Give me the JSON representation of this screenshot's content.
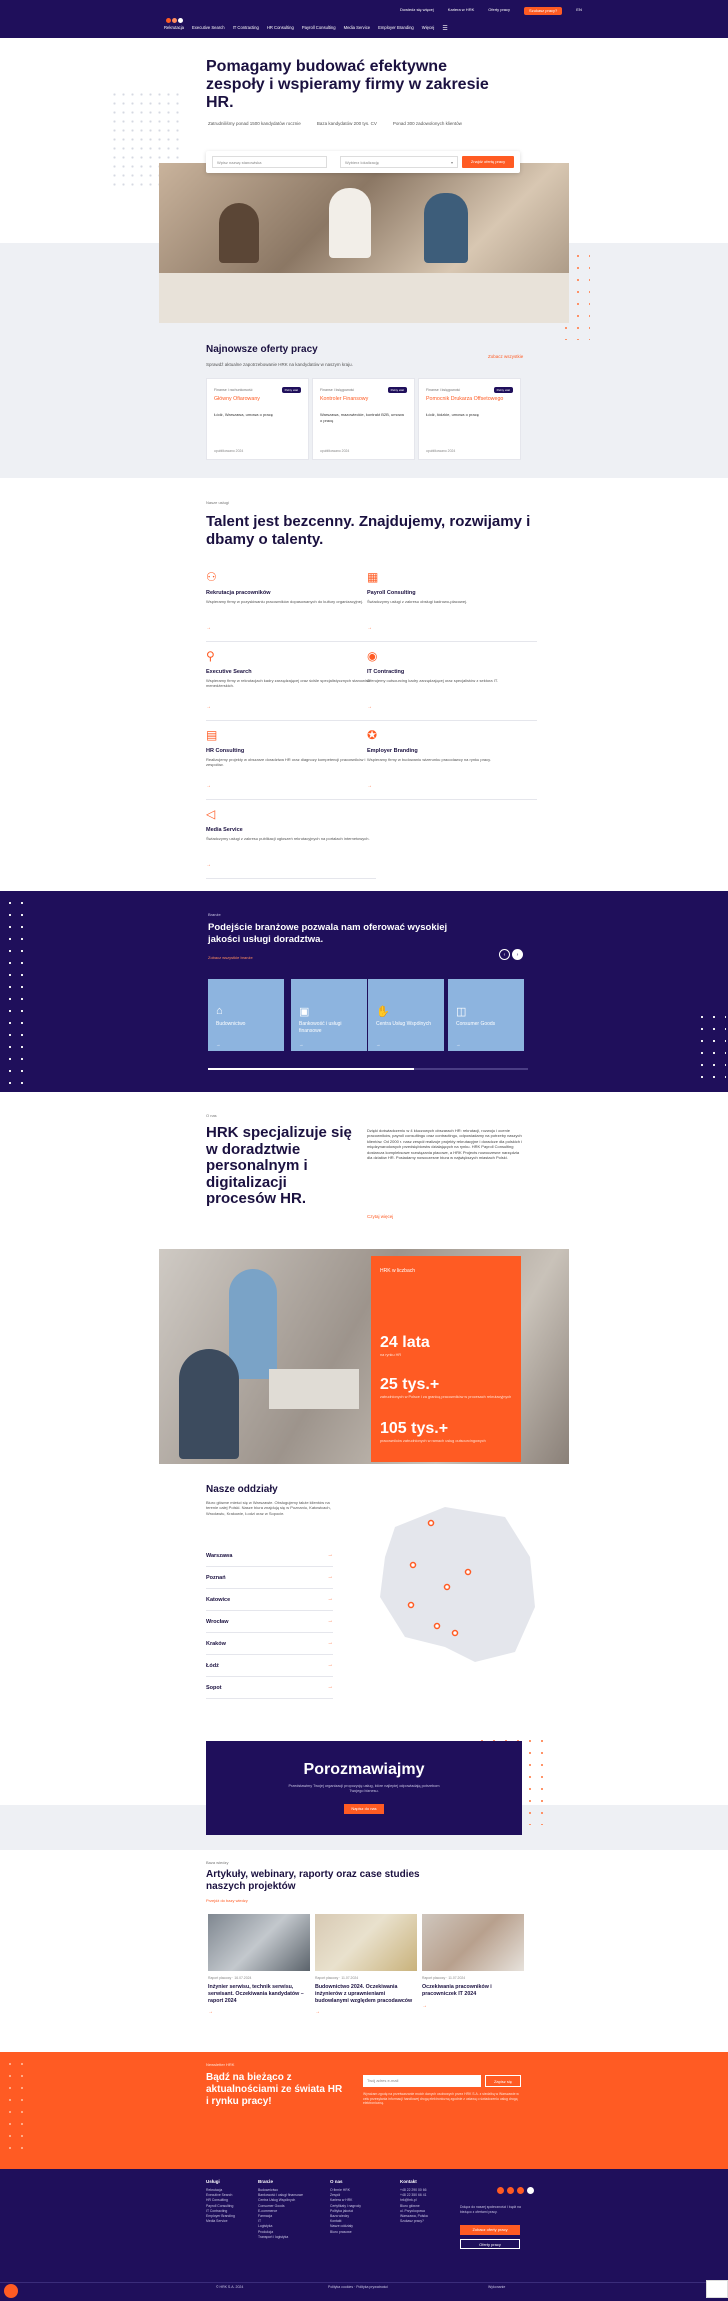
{
  "topbar": {
    "links": [
      "Dowiedz się więcej",
      "Kariera w HRK",
      "Oferty pracy",
      "Szukasz pracy?",
      "EN"
    ],
    "nav": [
      "Rekrutacja",
      "Executive Search",
      "IT Contracting",
      "HR Consulting",
      "Payroll Consulting",
      "Media Service",
      "Employer Branding",
      "Więcej"
    ]
  },
  "hero": {
    "title": "Pomagamy budować efektywne zespoły i wspieramy firmy w zakresie HR.",
    "stats": [
      "Zatrudniliśmy ponad 1500 kandydatów rocznie",
      "Baza kandydatów 200 tys. CV",
      "Ponad 300 zadowolonych klientów"
    ],
    "search_placeholder": "Wpisz nazwę stanowiska",
    "location_placeholder": "Wybierz lokalizację",
    "search_button": "Znajdź ofertę pracy"
  },
  "offers": {
    "title": "Najnowsze oferty pracy",
    "subtitle": "Sprawdź aktualne zapotrzebowanie HRK na kandydatów w naszym kraju.",
    "link": "Zobacz wszystkie",
    "items": [
      {
        "category": "Finanse i rachunkowość",
        "badge": "Pełny etat",
        "title": "Główny Ofiarowany",
        "location": "Łódź, Warszawa, umowa o pracę",
        "date": "opublikowano 2024"
      },
      {
        "category": "Finanse i księgowość",
        "badge": "Pełny etat",
        "title": "Kontroler Finansowy",
        "location": "Warszawa, mazowieckie, kontrakt B2B, umowa o pracę",
        "date": "opublikowano 2024"
      },
      {
        "category": "Finanse i księgowość",
        "badge": "Pełny etat",
        "title": "Pomocnik Drukarza Offsetowego",
        "location": "Łódź, łódzkie, umowa o pracę",
        "date": "opublikowano 2024"
      }
    ]
  },
  "services": {
    "eyebrow": "Nasze usługi",
    "title": "Talent jest bezcenny. Znajdujemy, rozwijamy i dbamy o talenty.",
    "items": [
      {
        "name": "Rekrutacja pracowników",
        "desc": "Wspieramy firmy w pozyskiwaniu pracowników dopasowanych do kultury organizacyjnej."
      },
      {
        "name": "Payroll Consulting",
        "desc": "Świadczymy usługi z zakresu obsługi kadrowo-płacowej."
      },
      {
        "name": "Executive Search",
        "desc": "Wspieramy firmy w rekrutacjach kadry zarządzającej oraz ściśle specjalistycznych stanowisk menedżerskich."
      },
      {
        "name": "IT Contracting",
        "desc": "Oferujemy outsourcing kadry zarządzającej oraz specjalistów z sektora IT."
      },
      {
        "name": "HR Consulting",
        "desc": "Realizujemy projekty w obszarze doradztwa HR oraz diagnozy kompetencji pracowników i zespołów."
      },
      {
        "name": "Employer Branding",
        "desc": "Wspieramy firmy w budowaniu wizerunku pracodawcy na rynku pracy."
      },
      {
        "name": "Media Service",
        "desc": "Świadczymy usługi z zakresu publikacji ogłoszeń rekrutacyjnych na portalach internetowych."
      }
    ]
  },
  "industries": {
    "eyebrow": "Branże",
    "title": "Podejście branżowe pozwala nam oferować wysokiej jakości usługi doradztwa.",
    "link": "Zobacz wszystkie branże",
    "cards": [
      "Budownictwo",
      "Bankowość i usługi finansowe",
      "Centra Usług Wspólnych",
      "Consumer Goods"
    ]
  },
  "about": {
    "eyebrow": "O nas",
    "title": "HRK specjalizuje się w doradztwie personalnym i digitalizacji procesów HR.",
    "text": "Dzięki doświadczeniu w 4 kluczowych obszarach HR: rekrutacji, rozwoju i ocenie pracowników, payroll consultingu oraz contractingu, odpowiadamy na potrzeby naszych klientów. Od 2000 r. nasz zespół realizuje projekty rekrutacyjne i doradcze dla polskich i międzynarodowych przedsiębiorstw działających na rynku. HRK Payroll Consulting dostarcza kompleksowe rozwiązania płacowe, a HRK Projects nowoczesne narzędzia dla działów HR. Posiadamy nowoczesne biura w największych miastach Polski.",
    "link": "Czytaj więcej"
  },
  "stats": {
    "heading": "HRK w liczbach",
    "items": [
      {
        "value": "24 lata",
        "label": "na rynku HR"
      },
      {
        "value": "25 tys.+",
        "label": "zatrudnionych w Polsce i za granicą pracowników w procesach rekrutacyjnych"
      },
      {
        "value": "105 tys.+",
        "label": "pracowników zatrudnionych w ramach usług outsourcingowych"
      }
    ]
  },
  "branches": {
    "title": "Nasze oddziały",
    "desc": "Biuro główne mieści się w Warszawie. Obsługujemy także klientów na terenie całej Polski. Nasze biura znajdują się w Poznaniu, Katowicach, Wrocławiu, Krakowie, Łodzi oraz w Sopocie.",
    "items": [
      "Warszawa",
      "Poznań",
      "Katowice",
      "Wrocław",
      "Kraków",
      "Łódź",
      "Sopot"
    ]
  },
  "contact": {
    "title": "Porozmawiajmy",
    "subtitle": "Przedstawimy Twojej organizacji propozycję usług, które najlepiej odpowiadają potrzebom Twojego biznesu.",
    "button": "Napisz do nas"
  },
  "knowledge": {
    "eyebrow": "Baza wiedzy",
    "title": "Artykuły, webinary, raporty oraz case studies naszych projektów",
    "link": "Przejdź do bazy wiedzy",
    "articles": [
      {
        "meta": "Raport płacowy · 16.07.2024",
        "title": "Inżynier serwisu, technik serwisu, serwisant. Oczekiwania kandydatów – raport 2024"
      },
      {
        "meta": "Raport płacowy · 11.07.2024",
        "title": "Budownictwo 2024. Oczekiwania inżynierów z uprawnieniami budowlanymi względem pracodawców"
      },
      {
        "meta": "Raport płacowy · 11.07.2024",
        "title": "Oczekiwania pracowników i pracowniczek IT 2024"
      }
    ]
  },
  "newsletter": {
    "eyebrow": "Newsletter HRK",
    "title": "Bądź na bieżąco z aktualnościami ze świata HR i rynku pracy!",
    "placeholder": "Twój adres e-mail",
    "button": "Zapisz się",
    "consent": "Wyrażam zgodę na przetwarzanie moich danych osobowych przez HRK S.A. z siedzibą w Warszawie w celu przesyłania informacji handlowej drogą elektroniczną zgodnie z ustawą o świadczeniu usług drogą elektroniczną."
  },
  "footer": {
    "columns": [
      {
        "heading": "Usługi",
        "items": [
          "Rekrutacja",
          "Executive Search",
          "HR Consulting",
          "Payroll Consulting",
          "IT Contracting",
          "Employer Branding",
          "Media Service"
        ]
      },
      {
        "heading": "Branże",
        "items": [
          "Budownictwo",
          "Bankowość i usługi finansowe",
          "Centra Usług Wspólnych",
          "Consumer Goods",
          "E-commerce",
          "Farmacja",
          "IT",
          "Logistyka",
          "Produkcja",
          "Transport i logistyka"
        ]
      },
      {
        "heading": "O nas",
        "items": [
          "O firmie HRK",
          "Zespół",
          "Kariera w HRK",
          "Certyfikaty i nagrody",
          "Polityka jakości",
          "Baza wiedzy",
          "Kontakt",
          "Nasze oddziały",
          "Biuro prasowe"
        ]
      },
      {
        "heading": "Kontakt",
        "items": [
          "+48 22 290 00 66",
          "+48 22 350 66 41",
          "hrk@hrk.pl",
          "Biuro główne",
          "ul. Przyokopowa",
          "Warszawa, Polska",
          "Szukasz pracy?"
        ]
      }
    ],
    "cta_text": "Dołącz do naszej społeczności i bądź na bieżąco z ofertami pracy.",
    "cta_button1": "Zobacz oferty pracy",
    "cta_button2": "Oferty pracy",
    "copyright": "© HRK S.A. 2024",
    "bottom_links": "Polityka cookies · Polityka prywatności",
    "made_by": "Wykonanie"
  },
  "colors": {
    "navy": "#1f0f5b",
    "orange": "#ff5b23",
    "sky": "#8db4df"
  }
}
